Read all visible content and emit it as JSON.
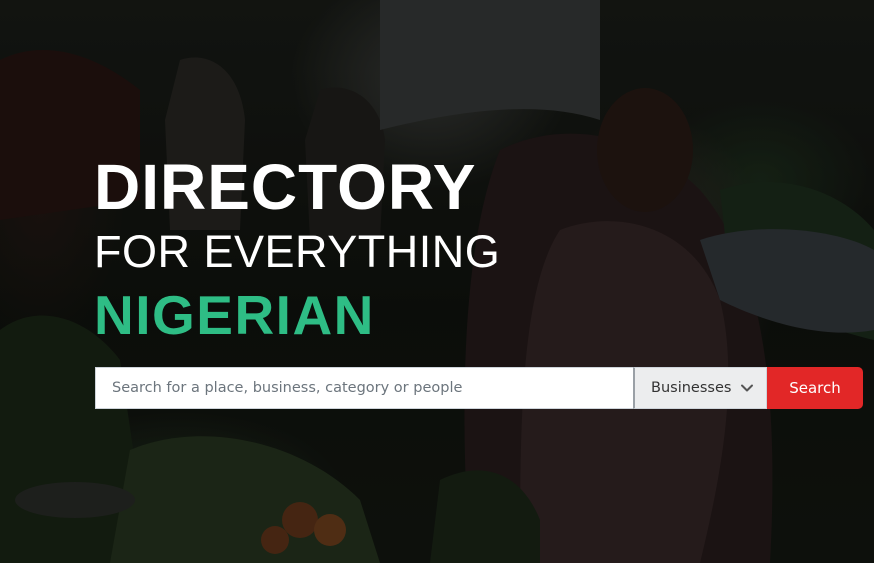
{
  "hero": {
    "headline": {
      "line1": "DIRECTORY",
      "line2": "FOR EVERYTHING",
      "line3": "NIGERIAN"
    }
  },
  "search": {
    "placeholder": "Search for a place, business, category or people",
    "category": {
      "selected": "Businesses"
    },
    "button_label": "Search"
  },
  "colors": {
    "accent_green": "#2ebd85",
    "button_red": "#e22727",
    "headline_white": "#ffffff"
  },
  "icons": {
    "dropdown": "chevron-down-icon"
  }
}
